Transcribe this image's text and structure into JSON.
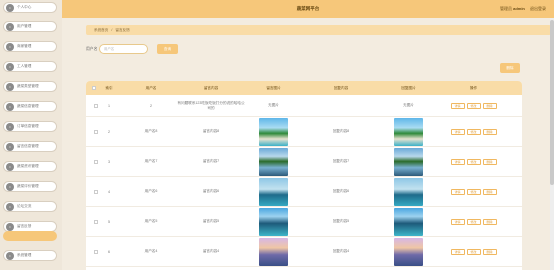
{
  "app": {
    "title": "蔬菜网平台",
    "user_prefix": "管理员",
    "user_name": "admin",
    "logout": "退出登录"
  },
  "sidebar": {
    "items": [
      {
        "label": "个人中心"
      },
      {
        "label": "用户管理"
      },
      {
        "label": "商家管理"
      },
      {
        "label": "工人管理"
      },
      {
        "label": "蔬菜类型管理"
      },
      {
        "label": "蔬菜信息管理"
      },
      {
        "label": "订单信息管理"
      },
      {
        "label": "留言信息管理"
      },
      {
        "label": "蔬菜资讯管理"
      },
      {
        "label": "蔬菜评价管理"
      },
      {
        "label": "论坛交流"
      },
      {
        "label": "留言反馈"
      },
      {
        "label": "系统管理"
      }
    ]
  },
  "breadcrumb": {
    "home": "系统首页",
    "current": "留言反馈"
  },
  "search": {
    "label": "用户名",
    "placeholder": "用户名",
    "button": "查询"
  },
  "delete_button": "删除",
  "table": {
    "headers": [
      "索引",
      "用户名",
      "留言内容",
      "留言图片",
      "回复内容",
      "回复图片",
      "操作"
    ],
    "ops": [
      "详情",
      "修改",
      "删除"
    ],
    "rows": [
      {
        "index": "1",
        "user": "2",
        "content": "有问题联系123吃饭吃饭打分的说的哈哈公司的",
        "image": "无图片",
        "reply": "",
        "reply_image": "无图片"
      },
      {
        "index": "2",
        "user": "用户名8",
        "content": "留言内容8",
        "image": "photo-a",
        "reply": "回复内容8",
        "reply_image": "photo-a"
      },
      {
        "index": "3",
        "user": "用户名7",
        "content": "留言内容7",
        "image": "photo-b",
        "reply": "回复内容7",
        "reply_image": "photo-b"
      },
      {
        "index": "4",
        "user": "用户名6",
        "content": "留言内容6",
        "image": "photo-c",
        "reply": "回复内容6",
        "reply_image": "photo-c"
      },
      {
        "index": "5",
        "user": "用户名5",
        "content": "留言内容5",
        "image": "photo-d",
        "reply": "回复内容5",
        "reply_image": "photo-d"
      },
      {
        "index": "6",
        "user": "用户名4",
        "content": "留言内容4",
        "image": "photo-e",
        "reply": "回复内容4",
        "reply_image": "photo-e"
      }
    ]
  }
}
